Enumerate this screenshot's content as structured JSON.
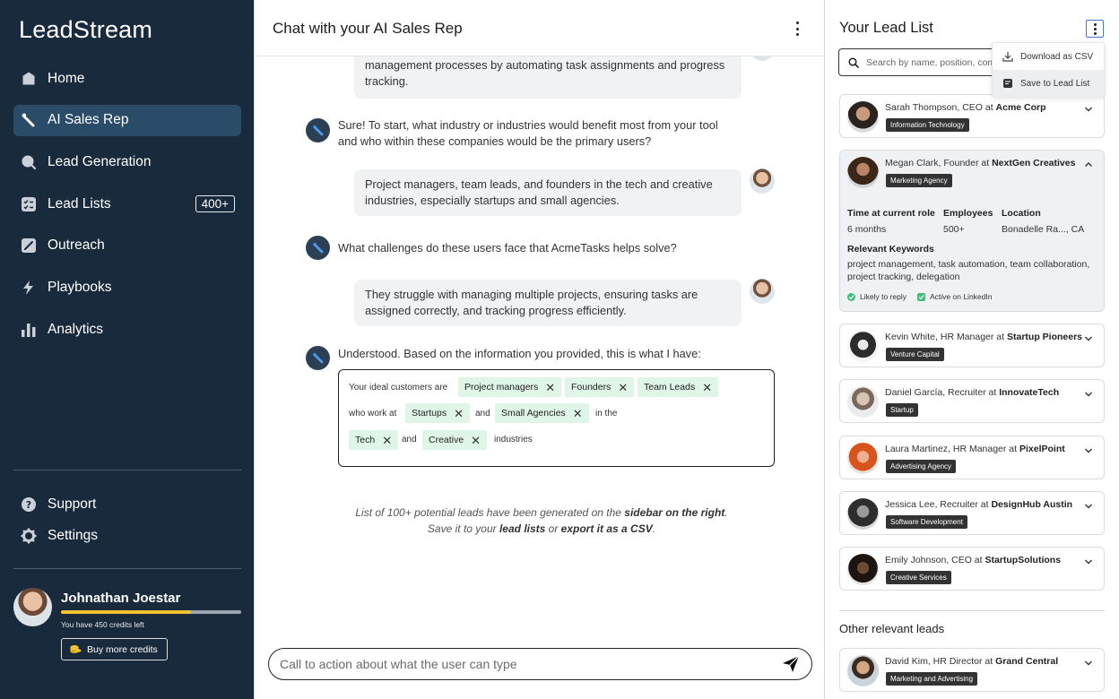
{
  "app": {
    "name": "LeadStream"
  },
  "sidebar": {
    "items": [
      {
        "label": "Home",
        "icon": "home-icon",
        "active": false
      },
      {
        "label": "AI Sales Rep",
        "icon": "ai-rep-icon",
        "active": true
      },
      {
        "label": "Lead Generation",
        "icon": "search-icon",
        "active": false
      },
      {
        "label": "Lead Lists",
        "icon": "checklist-icon",
        "active": false,
        "badge": "400+"
      },
      {
        "label": "Outreach",
        "icon": "pen-icon",
        "active": false
      },
      {
        "label": "Playbooks",
        "icon": "bolt-icon",
        "active": false
      },
      {
        "label": "Analytics",
        "icon": "bar-chart-icon",
        "active": false
      }
    ],
    "bottom": [
      {
        "label": "Support",
        "icon": "help-icon"
      },
      {
        "label": "Settings",
        "icon": "gear-icon"
      }
    ],
    "user": {
      "name": "Johnathan Joestar",
      "credits_text": "You have 450 credits left",
      "credits_fraction": 0.72,
      "buy_label": "Buy more credits"
    }
  },
  "chat": {
    "title": "Chat with your AI Sales Rep",
    "messages": [
      {
        "from": "user",
        "text": "management processes by automating task assignments and progress tracking."
      },
      {
        "from": "ai",
        "text": "Sure! To start, what industry or industries would benefit most from your tool and who within these companies would be the primary users?"
      },
      {
        "from": "user",
        "text": "Project managers, team leads, and founders in the tech and creative industries, especially startups and small agencies."
      },
      {
        "from": "ai",
        "text": "What challenges do these users face that AcmeTasks helps solve?"
      },
      {
        "from": "user",
        "text": "They struggle with managing multiple projects, ensuring tasks are assigned correctly, and tracking progress efficiently."
      },
      {
        "from": "ai",
        "text": "Understood. Based on the information you provided, this is what I have:"
      }
    ],
    "icp": {
      "intro": "Your ideal customers are",
      "who_work_at": "who work at",
      "and": "and",
      "in_the": "in the",
      "industries": "industries",
      "roles": [
        "Project managers",
        "Founders",
        "Team Leads"
      ],
      "company_types": [
        "Startups",
        "Small Agencies"
      ],
      "industry_list": [
        "Tech",
        "Creative"
      ]
    },
    "note": {
      "p1": "List of 100+ potential leads have been generated on the ",
      "b1": "sidebar on the right",
      "p2": ".",
      "p3": "Save it to your ",
      "b2": "lead lists",
      "p4": " or ",
      "b3": "export it as a CSV",
      "p5": "."
    },
    "composer_placeholder": "Call to action about what the user can type"
  },
  "leads": {
    "title": "Your Lead List",
    "search_placeholder": "Search by name, position, company",
    "menu": [
      "Download as CSV",
      "Save to Lead List"
    ],
    "list": [
      {
        "person": "Sarah Thompson, CEO at ",
        "company": "Acme Corp",
        "tag": "Information Technology"
      },
      {
        "person": "Megan Clark, Founder at ",
        "company": "NextGen Creatives",
        "tag": "Marketing Agency"
      },
      {
        "person": "Kevin White, HR Manager at ",
        "company": "Startup Pioneers",
        "tag": "Venture Capital"
      },
      {
        "person": "Daniel García, Recruiter at ",
        "company": "InnovateTech",
        "tag": "Startup"
      },
      {
        "person": "Laura Martinez, HR Manager at ",
        "company": "PixelPoint",
        "tag": "Advertising Agency"
      },
      {
        "person": "Jessica Lee, Recruiter at ",
        "company": "DesignHub Austin",
        "tag": "Software Development"
      },
      {
        "person": "Emily Johnson, CEO at ",
        "company": "StartupSolutions",
        "tag": "Creative Services"
      }
    ],
    "expanded": {
      "time_label": "Time at current role",
      "time_value": "6 months",
      "employees_label": "Employees",
      "employees_value": "500+",
      "location_label": "Location",
      "location_value": "Bonadelle Ra..., CA",
      "keywords_label": "Relevant Keywords",
      "keywords_value": "project management, task automation, team collaboration, project tracking, delegation",
      "status1": "Likely to reply",
      "status2": "Active on LinkedIn"
    },
    "other_title": "Other relevant leads",
    "other": [
      {
        "person": "David Kim, HR Director at ",
        "company": "Grand Central",
        "tag": "Marketing and Advertising"
      }
    ]
  }
}
